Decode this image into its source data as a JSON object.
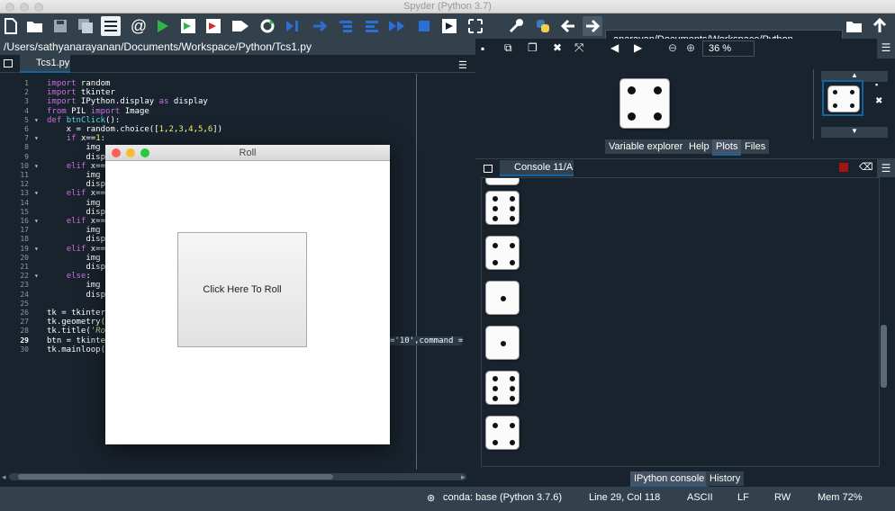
{
  "app": {
    "title": "Spyder (Python 3.7)"
  },
  "toolbar": {
    "icons": [
      "new-file",
      "open-file",
      "save",
      "save-all",
      "outline",
      "at-sign",
      "run",
      "run-cell",
      "run-cell-advance",
      "run-selection",
      "restart",
      "debug",
      "step",
      "step-into",
      "step-return",
      "continue",
      "stop",
      "maximize",
      "settings",
      "python",
      "back",
      "forward"
    ],
    "path": "anarayan/Documents/Workspace/Python"
  },
  "editor": {
    "file_path": "/Users/sathyanarayanan/Documents/Workspace/Python/Tcs1.py",
    "tab": "Tcs1.py",
    "line_numbers": [
      "1",
      "2",
      "3",
      "4",
      "5",
      "6",
      "7",
      "8",
      "9",
      "10",
      "11",
      "12",
      "13",
      "14",
      "15",
      "16",
      "17",
      "18",
      "19",
      "20",
      "21",
      "22",
      "23",
      "24",
      "25",
      "26",
      "27",
      "28",
      "29",
      "30"
    ],
    "active_line": "29",
    "hidden_tail": "='10',command ="
  },
  "roll_window": {
    "title": "Roll",
    "button": "Click Here To Roll"
  },
  "plots": {
    "zoom": "36 %",
    "tabs": [
      "Variable explorer",
      "Help",
      "Plots",
      "Files"
    ],
    "active_tab": "Plots"
  },
  "console": {
    "tab": "Console 11/A",
    "bottom_tabs": [
      "IPython console",
      "History"
    ],
    "dice": [
      6,
      4,
      1,
      1,
      6,
      4
    ]
  },
  "status": {
    "conda": "conda: base (Python 3.7.6)",
    "position": "Line 29, Col 118",
    "encoding": "ASCII",
    "eol": "LF",
    "perm": "RW",
    "mem": "Mem 72%"
  }
}
